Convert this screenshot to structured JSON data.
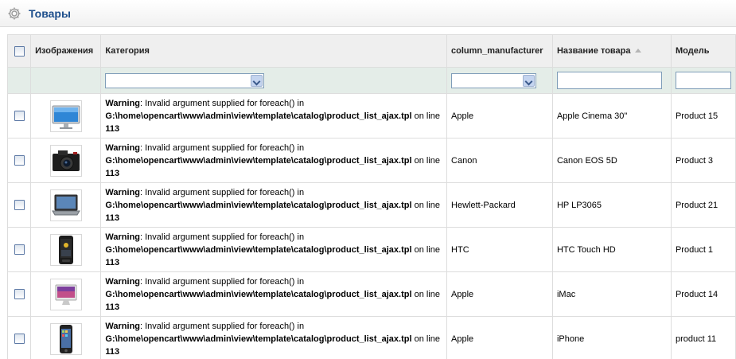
{
  "heading": {
    "title": "Товары",
    "icon": "gear-icon"
  },
  "columns": {
    "image": "Изображения",
    "category": "Категория",
    "manufacturer": "column_manufacturer",
    "name": "Название товара",
    "model": "Модель"
  },
  "filters": {
    "category": "",
    "manufacturer": "",
    "name": "",
    "model": ""
  },
  "rows": [
    {
      "image": "monitor-image",
      "warning": {
        "label": "Warning",
        "message": ": Invalid argument supplied for foreach() in ",
        "path": "G:\\home\\opencart\\www\\admin\\view\\template\\catalog\\product_list_ajax.tpl",
        "line_text": " on line ",
        "line": "113"
      },
      "manufacturer": "Apple",
      "name": "Apple Cinema 30\"",
      "model": "Product 15"
    },
    {
      "image": "camera-image",
      "warning": {
        "label": "Warning",
        "message": ": Invalid argument supplied for foreach() in ",
        "path": "G:\\home\\opencart\\www\\admin\\view\\template\\catalog\\product_list_ajax.tpl",
        "line_text": " on line ",
        "line": "113"
      },
      "manufacturer": "Canon",
      "name": "Canon EOS 5D",
      "model": "Product 3"
    },
    {
      "image": "laptop-image",
      "warning": {
        "label": "Warning",
        "message": ": Invalid argument supplied for foreach() in ",
        "path": "G:\\home\\opencart\\www\\admin\\view\\template\\catalog\\product_list_ajax.tpl",
        "line_text": " on line ",
        "line": "113"
      },
      "manufacturer": "Hewlett-Packard",
      "name": "HP LP3065",
      "model": "Product 21"
    },
    {
      "image": "smartphone-image",
      "warning": {
        "label": "Warning",
        "message": ": Invalid argument supplied for foreach() in ",
        "path": "G:\\home\\opencart\\www\\admin\\view\\template\\catalog\\product_list_ajax.tpl",
        "line_text": " on line ",
        "line": "113"
      },
      "manufacturer": "HTC",
      "name": "HTC Touch HD",
      "model": "Product 1"
    },
    {
      "image": "imac-image",
      "warning": {
        "label": "Warning",
        "message": ": Invalid argument supplied for foreach() in ",
        "path": "G:\\home\\opencart\\www\\admin\\view\\template\\catalog\\product_list_ajax.tpl",
        "line_text": " on line ",
        "line": "113"
      },
      "manufacturer": "Apple",
      "name": "iMac",
      "model": "Product 14"
    },
    {
      "image": "iphone-image",
      "warning": {
        "label": "Warning",
        "message": ": Invalid argument supplied for foreach() in ",
        "path": "G:\\home\\opencart\\www\\admin\\view\\template\\catalog\\product_list_ajax.tpl",
        "line_text": " on line ",
        "line": "113"
      },
      "manufacturer": "Apple",
      "name": "iPhone",
      "model": "product 11"
    }
  ]
}
